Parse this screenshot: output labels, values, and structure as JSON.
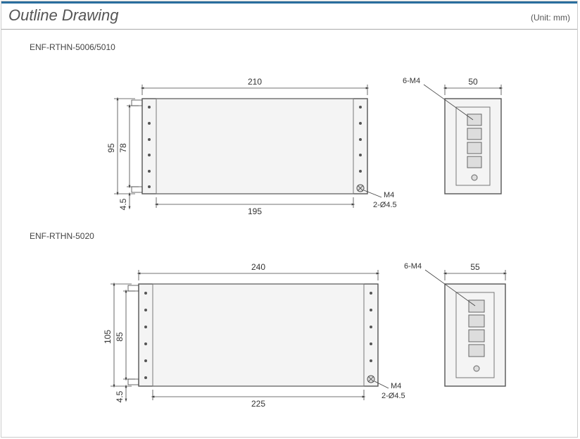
{
  "header": {
    "title": "Outline Drawing",
    "unit": "(Unit: mm)"
  },
  "models": [
    {
      "name": "ENF-RTHN-5006/5010",
      "dims": {
        "width_top": "210",
        "width_bottom": "195",
        "height_outer": "95",
        "height_inner": "78",
        "offset_bottom": "4.5",
        "side_width": "50",
        "screw_count": "6-M4",
        "screw_type": "M4",
        "hole": "2-Ø4.5"
      }
    },
    {
      "name": "ENF-RTHN-5020",
      "dims": {
        "width_top": "240",
        "width_bottom": "225",
        "height_outer": "105",
        "height_inner": "85",
        "offset_bottom": "4.5",
        "side_width": "55",
        "screw_count": "6-M4",
        "screw_type": "M4",
        "hole": "2-Ø4.5"
      }
    }
  ]
}
